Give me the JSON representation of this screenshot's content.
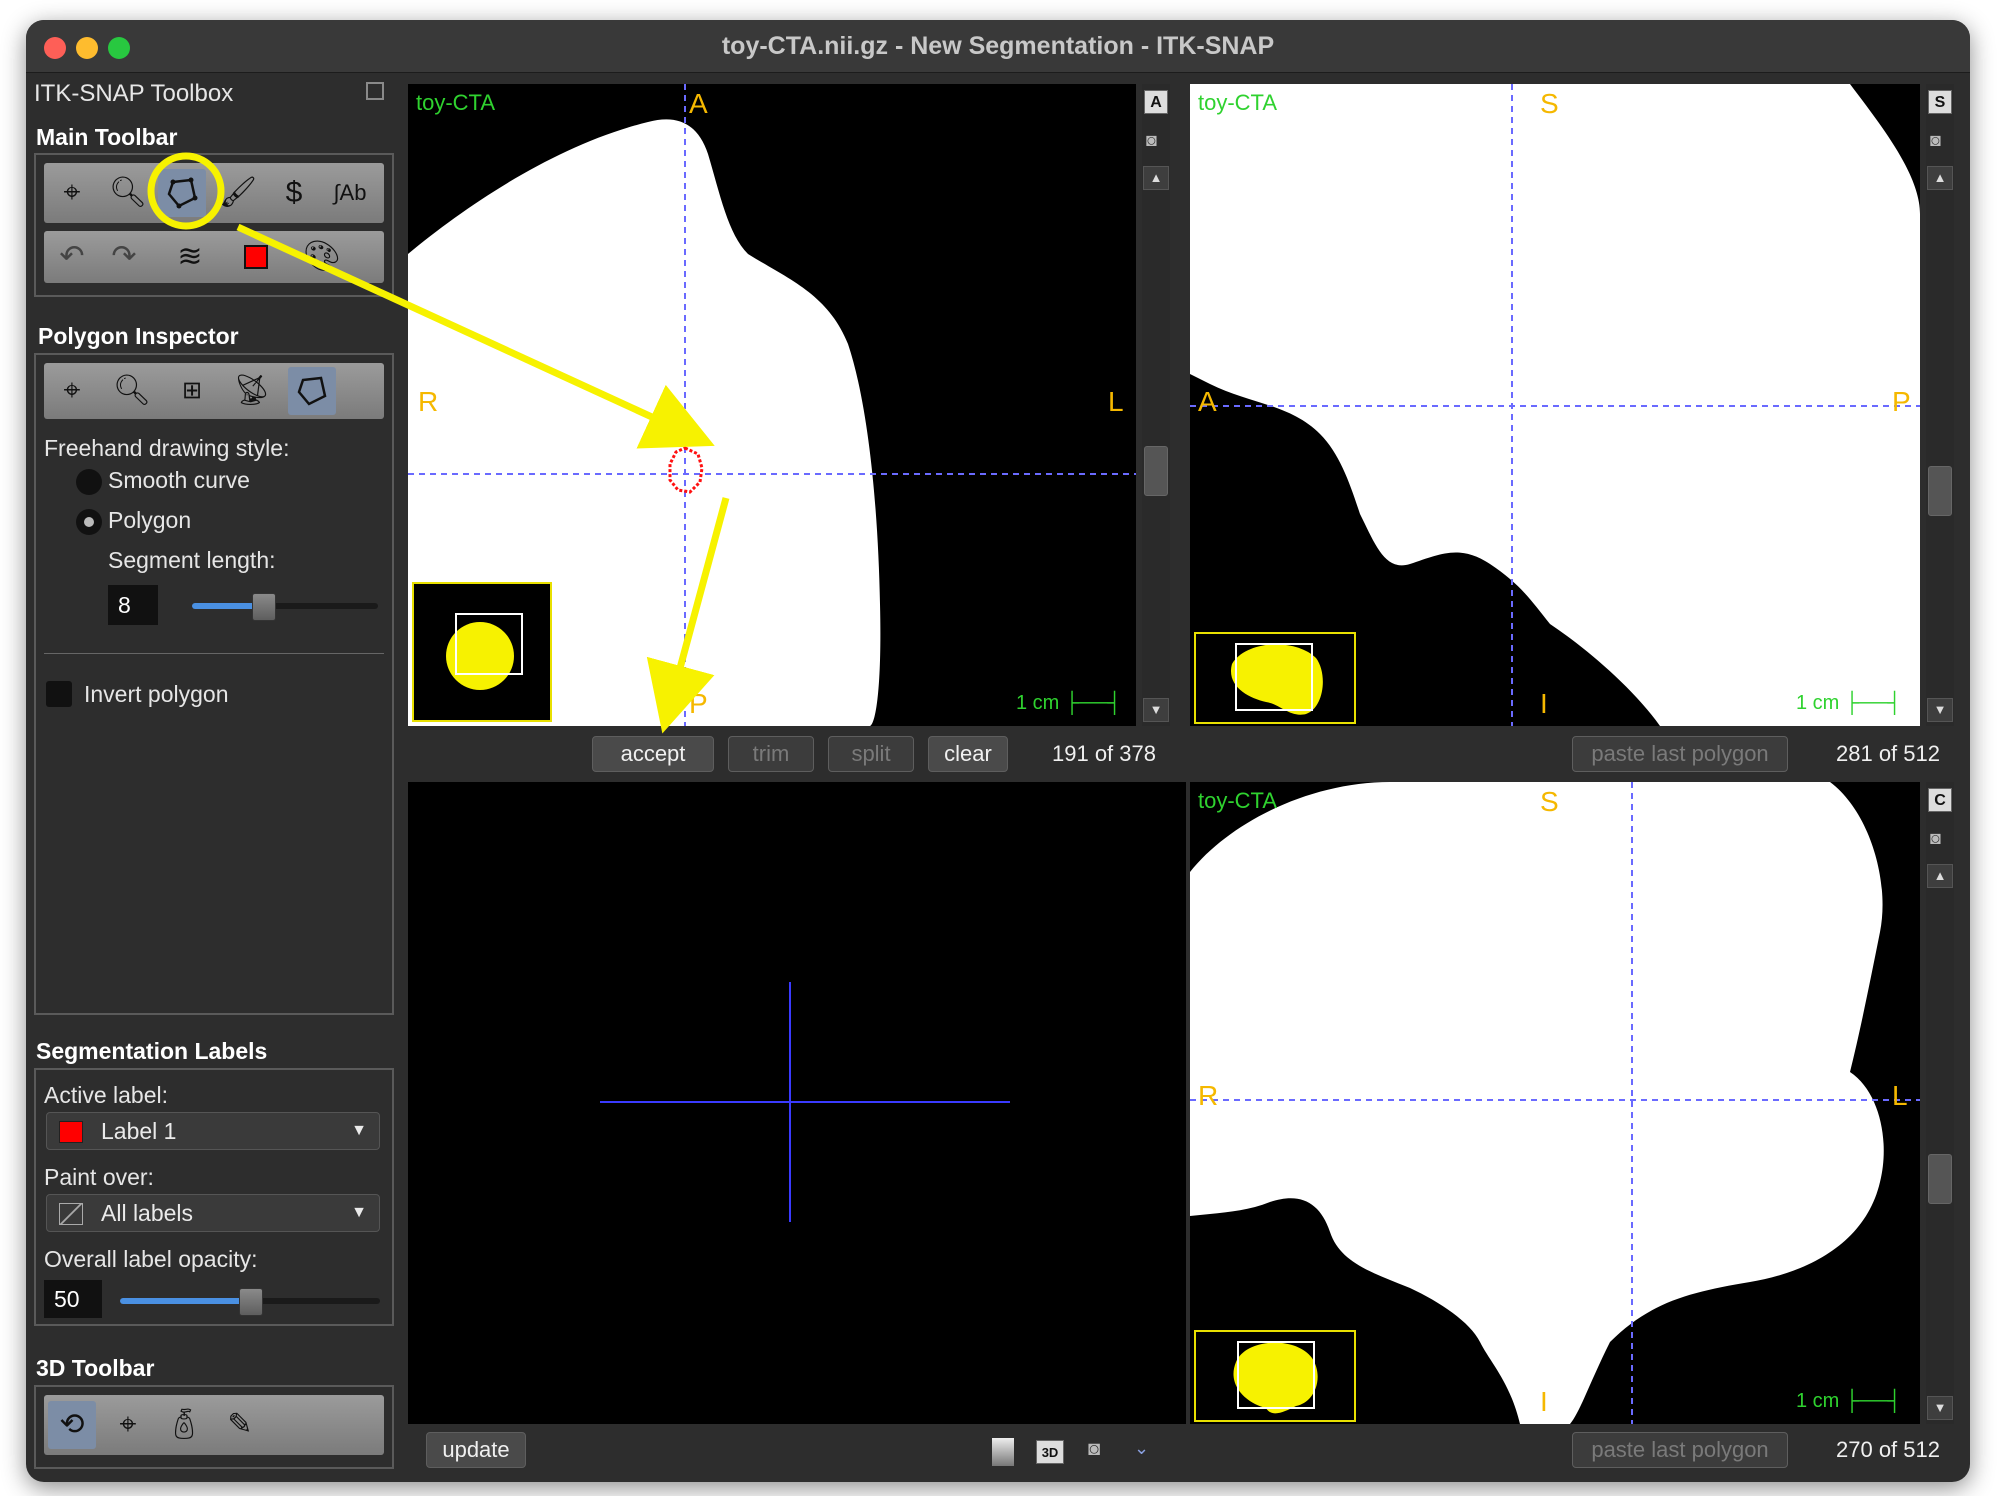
{
  "window": {
    "title": "toy-CTA.nii.gz - New Segmentation - ITK-SNAP",
    "traffic_colors": [
      "#fe5f57",
      "#febc2e",
      "#28c840"
    ]
  },
  "sidebar": {
    "toolbox_title": "ITK-SNAP Toolbox",
    "main_toolbar": {
      "title": "Main Toolbar",
      "row1": [
        "crosshair-tool",
        "zoom-tool",
        "polygon-tool",
        "paintbrush-tool",
        "snake-tool",
        "annotation-tool"
      ],
      "row2": [
        "undo",
        "redo",
        "layers",
        "label-color",
        "palette"
      ]
    },
    "polygon_inspector": {
      "title": "Polygon Inspector",
      "tools": [
        "crosshair-tool",
        "zoom-tool",
        "layout-tool",
        "broadcast-tool",
        "polygon-tool"
      ],
      "freehand_label": "Freehand drawing style:",
      "smooth_curve": "Smooth curve",
      "polygon": "Polygon",
      "segment_length_label": "Segment length:",
      "segment_length": "8",
      "segment_slider_fraction": 0.38,
      "invert_polygon": "Invert polygon"
    },
    "segmentation_labels": {
      "title": "Segmentation Labels",
      "active_label_caption": "Active label:",
      "active_label": "Label 1",
      "active_label_color": "#ff0000",
      "paint_over_caption": "Paint over:",
      "paint_over": "All labels",
      "opacity_caption": "Overall label opacity:",
      "opacity": "50",
      "opacity_fraction": 0.5
    },
    "toolbar_3d": {
      "title": "3D Toolbar",
      "tools": [
        "rotate-3d-tool",
        "crosshair-3d-tool",
        "spray-tool",
        "scalpel-tool"
      ]
    }
  },
  "views": {
    "axial": {
      "label": "toy-CTA",
      "top": "A",
      "bottom": "P",
      "left": "R",
      "right": "L",
      "scale": "1 cm",
      "box": "A",
      "slice": "191 of 378",
      "buttons": {
        "accept": "accept",
        "trim": "trim",
        "split": "split",
        "clear": "clear"
      }
    },
    "sagittal": {
      "label": "toy-CTA",
      "top": "S",
      "bottom": "I",
      "left": "A",
      "right": "P",
      "scale": "1 cm",
      "box": "S",
      "paste": "paste last polygon",
      "slice": "281 of 512"
    },
    "coronal": {
      "label": "toy-CTA",
      "top": "S",
      "bottom": "I",
      "left": "R",
      "right": "L",
      "scale": "1 cm",
      "box": "C",
      "paste": "paste last polygon",
      "slice": "270 of 512"
    },
    "three_d": {
      "update": "update",
      "zoom_badge": "3D"
    }
  },
  "colors": {
    "annotation": "#f7f200",
    "crosshair": "#6a6aff",
    "overlay_text": "#2fd22f",
    "orientation": "#f5b800"
  }
}
